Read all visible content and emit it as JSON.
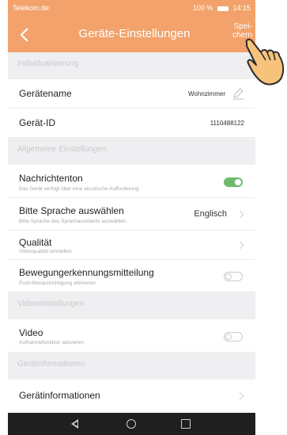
{
  "status_bar": {
    "carrier": "Telekom.de",
    "signal_battery": "100 %",
    "time": "14:15"
  },
  "header": {
    "back_icon": "chevron-left-icon",
    "title": "Geräte-Einstellungen",
    "save_line1": "Spei-",
    "save_line2": "chern"
  },
  "sections": {
    "individualisierung": "Individualisierung",
    "allgemeine": "Allgemeine Einstellungen",
    "videoeinstellungen": "Videoeinstellungen",
    "geraeteinformationen": "Gerätinformationen"
  },
  "rows": {
    "geraetename": {
      "label": "Gerätename",
      "value": "Wohnzimmer",
      "icon": "pencil-icon"
    },
    "geraet_id": {
      "label": "Gerät-ID",
      "value": "1110488122"
    },
    "nachrichtenton": {
      "label": "Nachrichtenton",
      "sub": "Das Gerät verfügt über eine akustische Aufforderung",
      "toggle_on": true
    },
    "sprache": {
      "label": "Bitte Sprache auswählen",
      "sub": "Bitte Sprache des Sprachassistents auswählen.",
      "value": "Englisch"
    },
    "qualitaet": {
      "label": "Qualität",
      "sub": "Videoqualität einstellen"
    },
    "bewegung": {
      "label": "Bewegungerkennungsmitteilung",
      "sub": "Push-Benachrichtigung aktivieren",
      "toggle_on": false
    },
    "video": {
      "label": "Video",
      "sub": "Aufnahmefunktion aktivieren",
      "toggle_on": false
    },
    "geraeteinformationen": {
      "label": "Gerätinformationen"
    }
  },
  "navbar": {
    "back_icon": "triangle-back-icon",
    "home_icon": "circle-home-icon",
    "recent_icon": "square-recent-icon"
  },
  "colors": {
    "accent": "#f2a26a",
    "toggle_on": "#6bba6e",
    "section_bg": "#efeff1",
    "navbar_bg": "#1f1f1f"
  }
}
